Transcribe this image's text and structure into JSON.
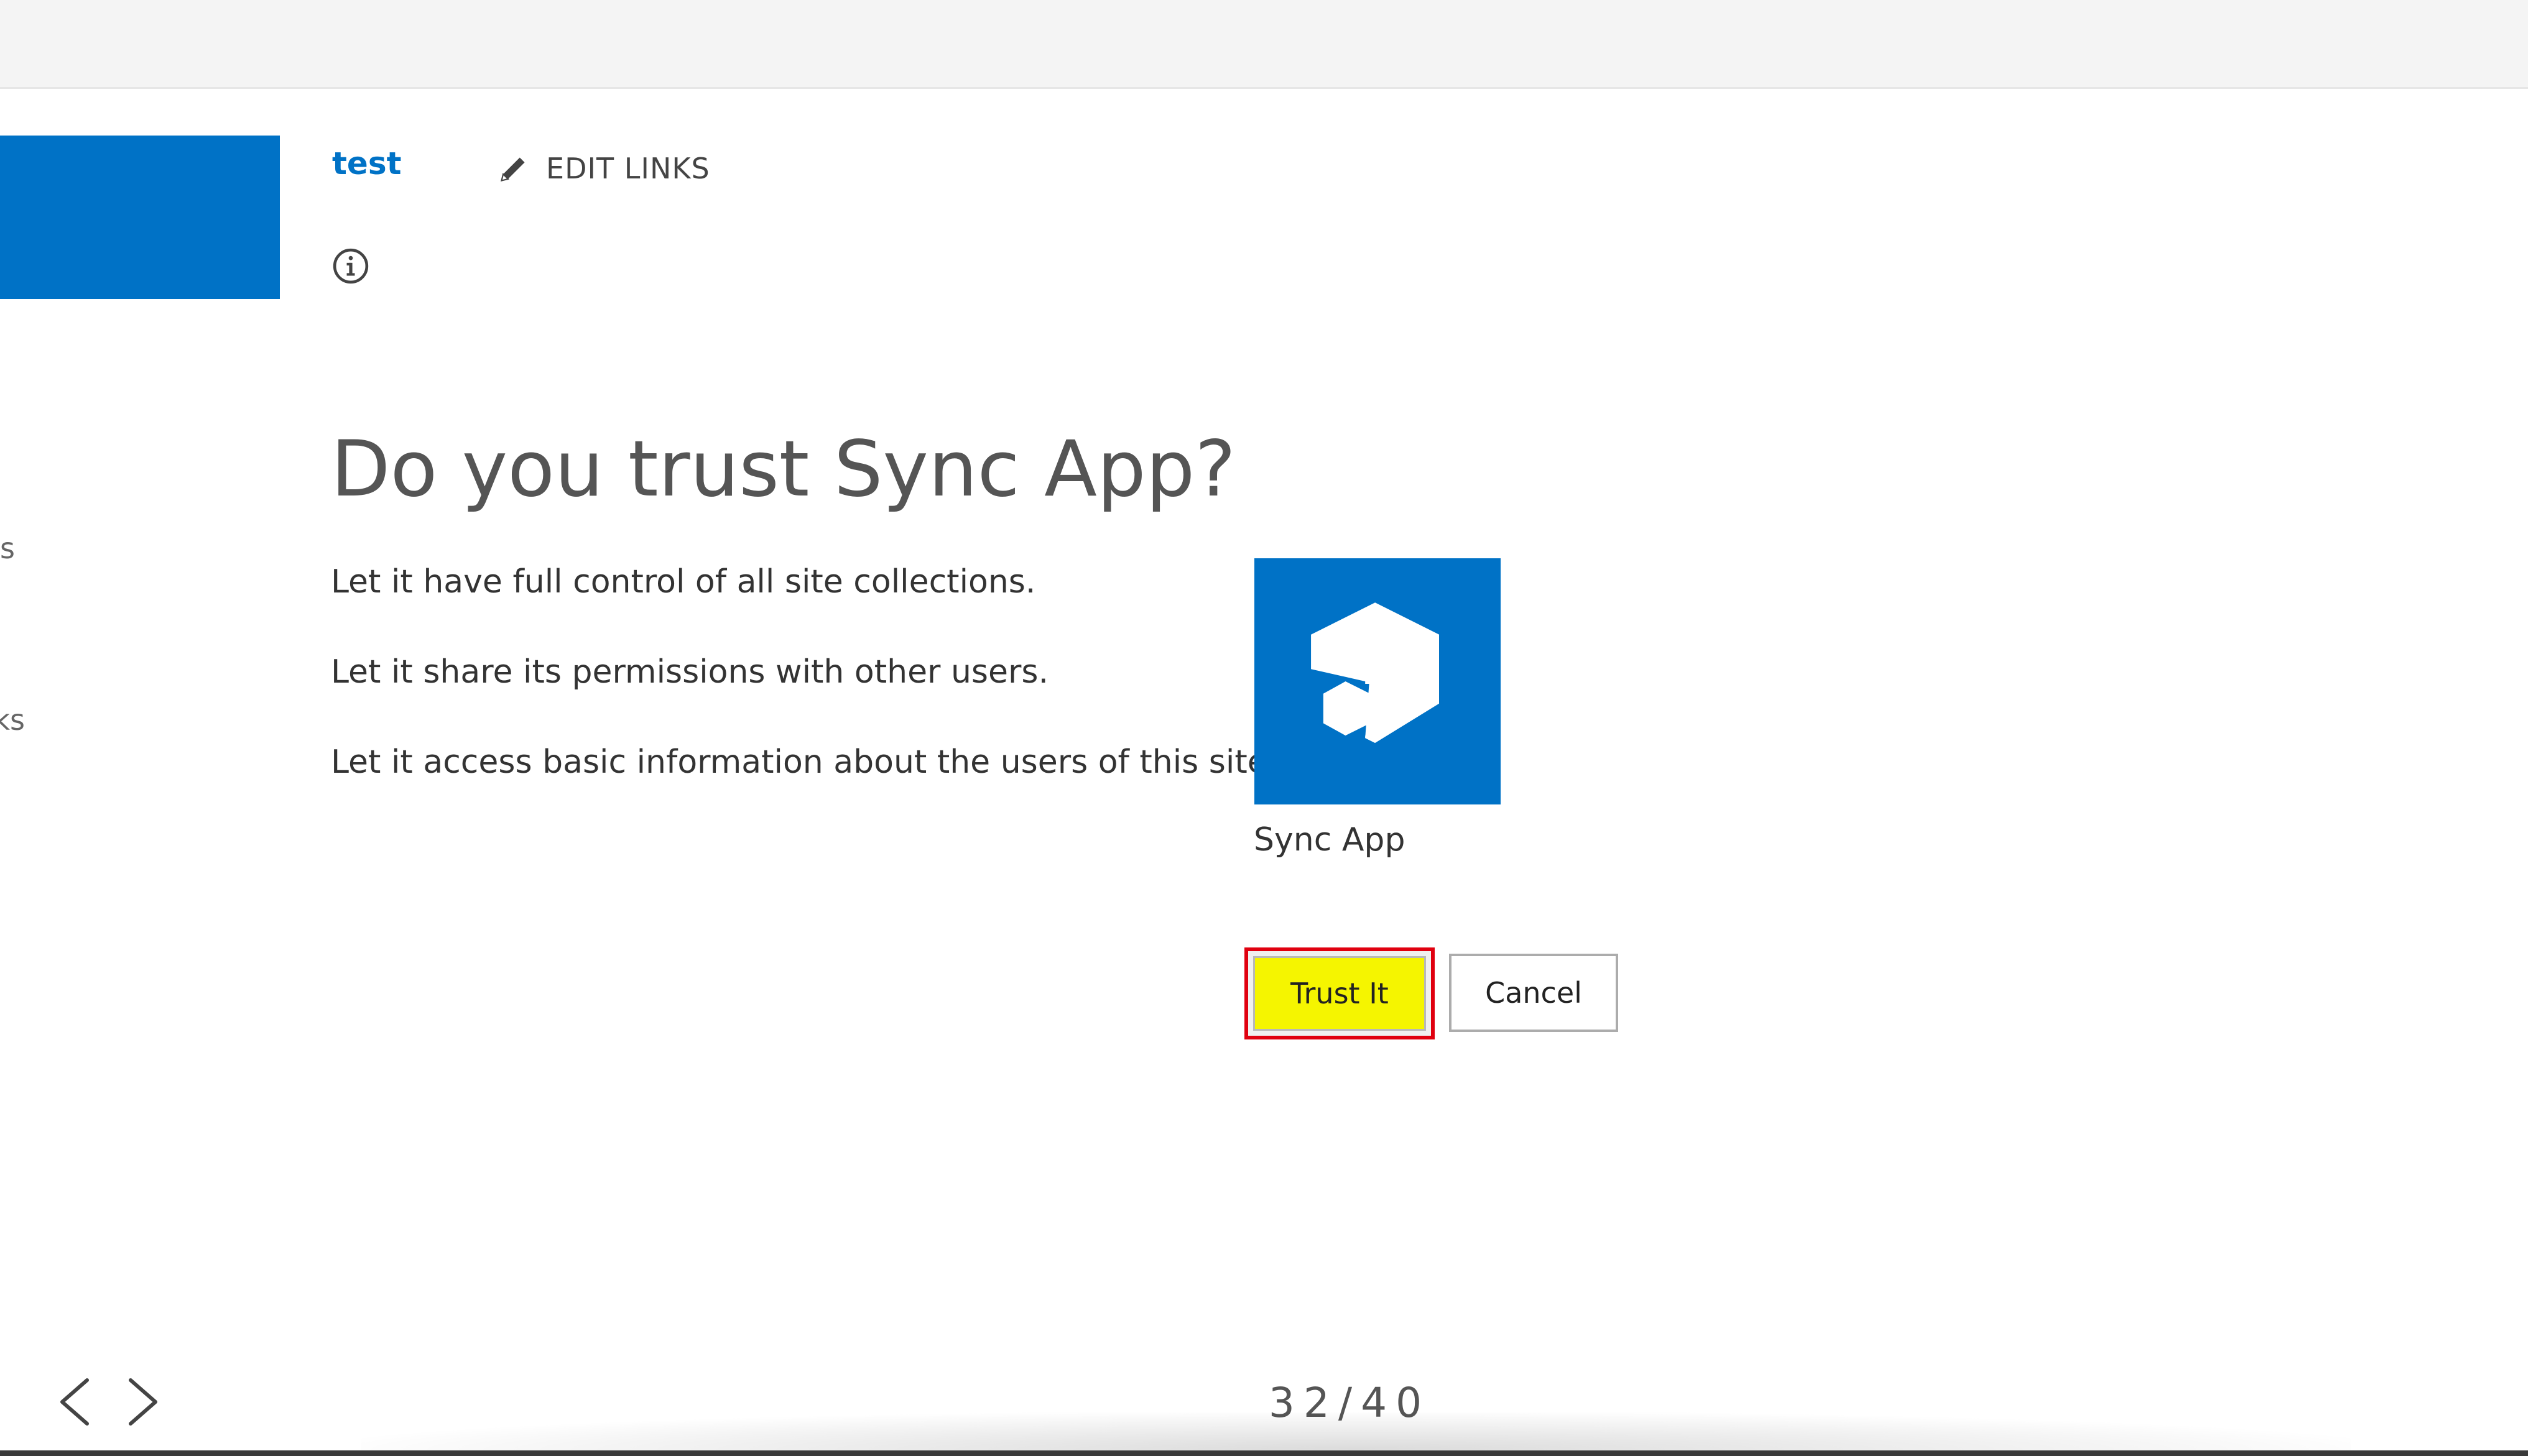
{
  "header": {
    "site_title": "test",
    "edit_links_label": "EDIT LINKS"
  },
  "left_nav": {
    "fragments": [
      "s",
      "ks"
    ]
  },
  "dialog": {
    "heading": "Do you trust Sync App?",
    "permissions": [
      "Let it have full control of all site collections.",
      "Let it share its permissions with other users.",
      "Let it access basic information about the users of this site."
    ],
    "app_name": "Sync App",
    "trust_label": "Trust It",
    "cancel_label": "Cancel"
  },
  "slideshow": {
    "counter": "32/40"
  },
  "colors": {
    "brand_blue": "#0072c6",
    "highlight_yellow": "#f5f500",
    "highlight_box_red": "#e0000f",
    "tile_blue": "#0072c6"
  },
  "icons": {
    "edit": "pencil-icon",
    "info": "info-icon",
    "app": "sync-app-icon",
    "prev": "chevron-left-icon",
    "next": "chevron-right-icon"
  }
}
